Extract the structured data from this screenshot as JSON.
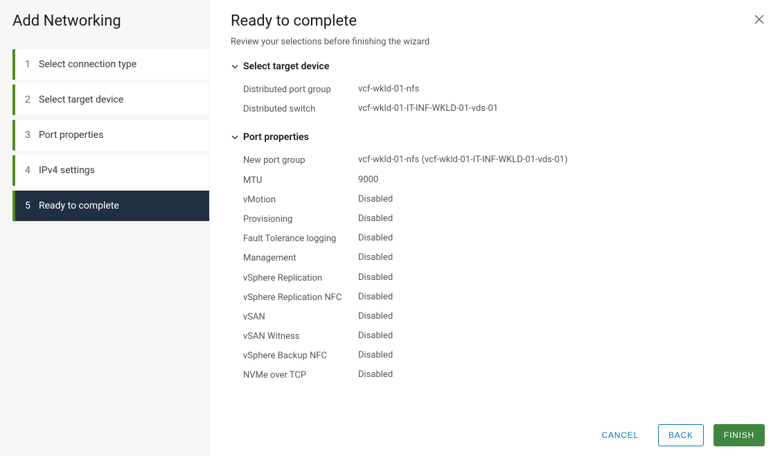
{
  "wizard": {
    "title": "Add Networking",
    "steps": [
      {
        "num": "1",
        "label": "Select connection type"
      },
      {
        "num": "2",
        "label": "Select target device"
      },
      {
        "num": "3",
        "label": "Port properties"
      },
      {
        "num": "4",
        "label": "IPv4 settings"
      },
      {
        "num": "5",
        "label": "Ready to complete"
      }
    ]
  },
  "main": {
    "title": "Ready to complete",
    "subtitle": "Review your selections before finishing the wizard",
    "sections": [
      {
        "title": "Select target device",
        "rows": [
          {
            "label": "Distributed port group",
            "value": "vcf-wkld-01-nfs"
          },
          {
            "label": "Distributed switch",
            "value": "vcf-wkld-01-IT-INF-WKLD-01-vds-01"
          }
        ]
      },
      {
        "title": "Port properties",
        "rows": [
          {
            "label": "New port group",
            "value": "vcf-wkld-01-nfs (vcf-wkld-01-IT-INF-WKLD-01-vds-01)"
          },
          {
            "label": "MTU",
            "value": "9000"
          },
          {
            "label": "vMotion",
            "value": "Disabled"
          },
          {
            "label": "Provisioning",
            "value": "Disabled"
          },
          {
            "label": "Fault Tolerance logging",
            "value": "Disabled"
          },
          {
            "label": "Management",
            "value": "Disabled"
          },
          {
            "label": "vSphere Replication",
            "value": "Disabled"
          },
          {
            "label": "vSphere Replication NFC",
            "value": "Disabled"
          },
          {
            "label": "vSAN",
            "value": "Disabled"
          },
          {
            "label": "vSAN Witness",
            "value": "Disabled"
          },
          {
            "label": "vSphere Backup NFC",
            "value": "Disabled"
          },
          {
            "label": "NVMe over TCP",
            "value": "Disabled"
          }
        ]
      }
    ]
  },
  "footer": {
    "cancel": "CANCEL",
    "back": "BACK",
    "finish": "FINISH"
  }
}
